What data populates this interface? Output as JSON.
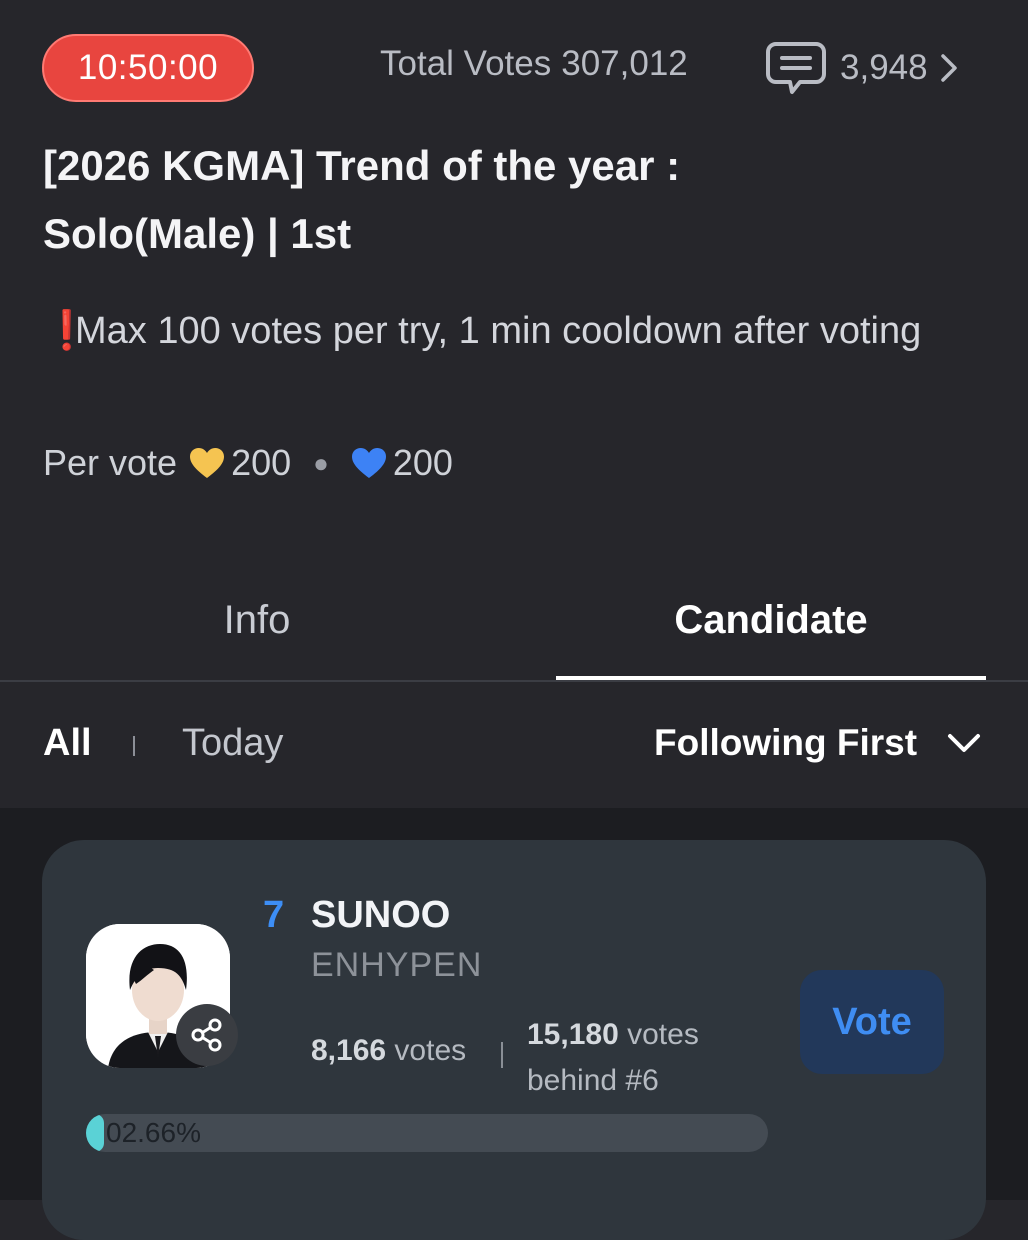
{
  "header": {
    "timer": "10:50:00",
    "total_votes_label": "Total Votes",
    "total_votes_value": "307,012",
    "comment_count": "3,948"
  },
  "event": {
    "title_line1": "[2026 KGMA] Trend of the year :",
    "title_line2": "Solo(Male) | 1st",
    "notice_icon": "❗",
    "notice": "Max 100 votes per try, 1 min cooldown after voting",
    "per_vote_label": "Per vote",
    "cost_gold": "200",
    "cost_blue": "200",
    "gold_heart_color": "#f5c451",
    "blue_heart_color": "#3d82f5"
  },
  "tabs": [
    {
      "label": "Info",
      "active": false
    },
    {
      "label": "Candidate",
      "active": true
    }
  ],
  "filters": {
    "all": "All",
    "today": "Today",
    "sort": "Following First"
  },
  "candidate": {
    "rank": "7",
    "name": "SUNOO",
    "group": "ENHYPEN",
    "votes_num": "8,166",
    "votes_unit": "votes",
    "behind_num": "15,180",
    "behind_text": "votes",
    "behind_rank": "behind #6",
    "vote_button": "Vote",
    "share_percent": "02.66%",
    "share_fraction": 0.0266
  },
  "colors": {
    "timer_bg": "#e8453f",
    "rank": "#3d8ef5",
    "progress": "#5ad2d6",
    "vote_button_bg": "#22385a"
  }
}
